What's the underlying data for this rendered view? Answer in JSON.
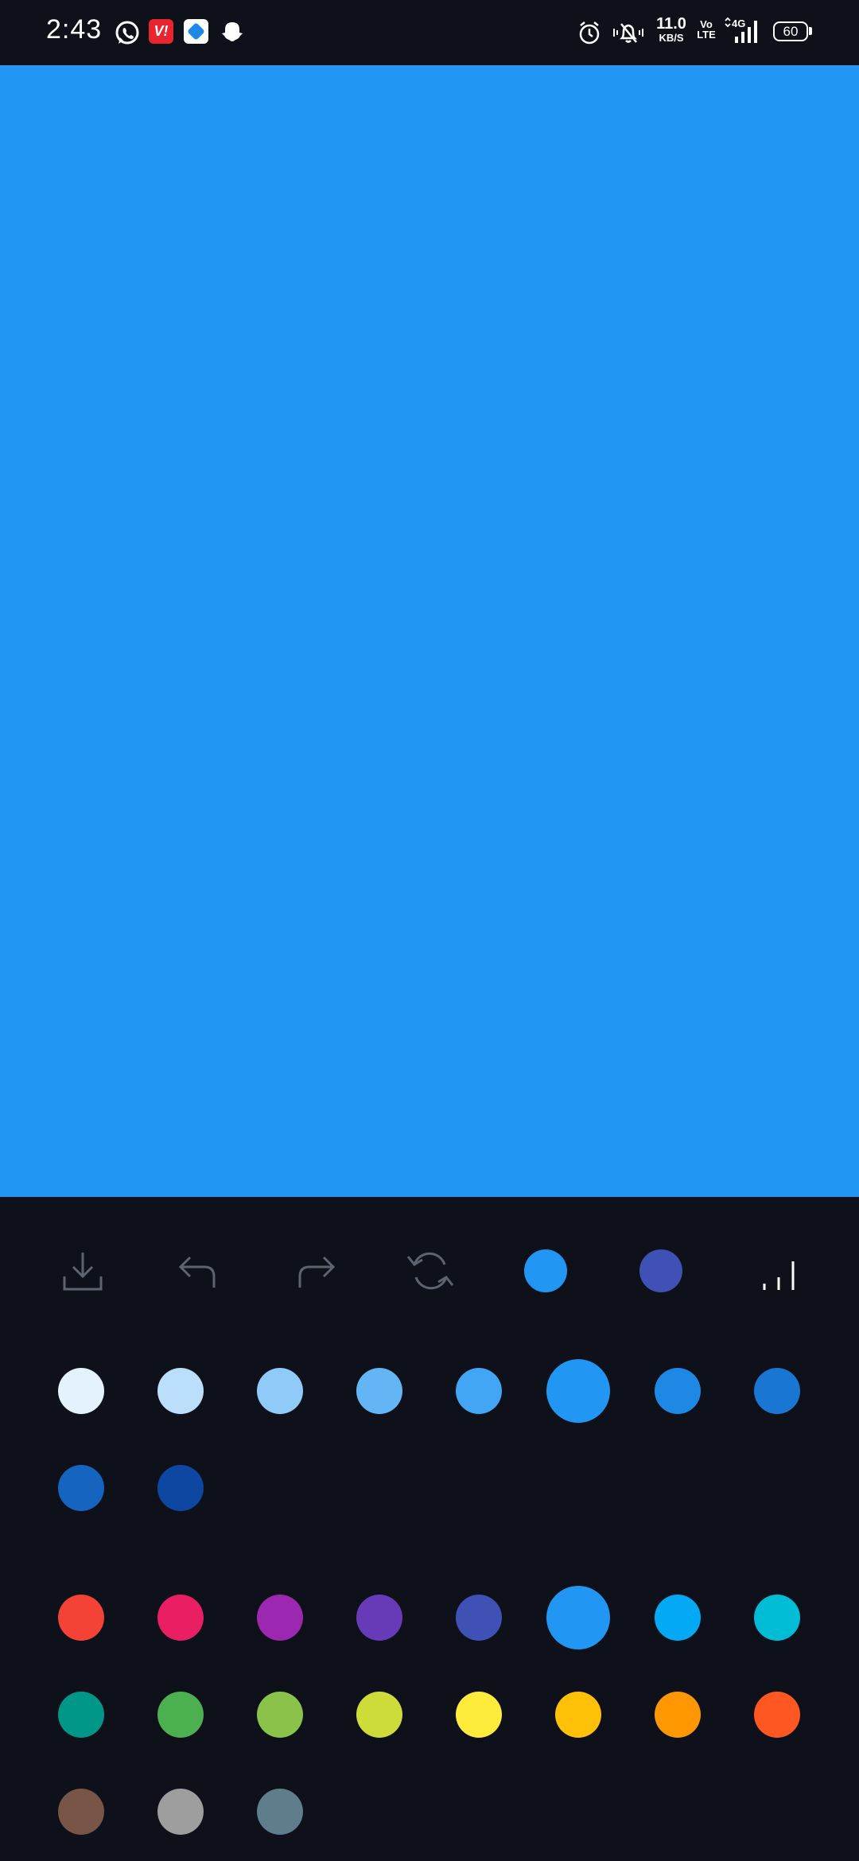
{
  "status_bar": {
    "time": "2:43",
    "net_speed_value": "11.0",
    "net_speed_unit": "KB/S",
    "volte_top": "Vo",
    "volte_bottom": "LTE",
    "network_type": "4G",
    "battery": "60",
    "notification_icons": [
      "whatsapp-icon",
      "vi-app-icon",
      "photo-app-icon",
      "snapchat-icon"
    ],
    "system_icons": [
      "alarm-icon",
      "vibrate-mute-icon",
      "signal-icon"
    ]
  },
  "canvas": {
    "color": "#2196f3"
  },
  "toolbar": {
    "tools": [
      "download-icon",
      "undo-icon",
      "redo-icon",
      "refresh-icon",
      "primary-color-swatch",
      "secondary-color-swatch",
      "brush-size-icon"
    ],
    "primary_color": "#2196f3",
    "secondary_color": "#3f51b5"
  },
  "shade_palette": {
    "colors": [
      "#e3f2fd",
      "#bbdefb",
      "#90caf9",
      "#64b5f6",
      "#42a5f5",
      "#2196f3",
      "#1e88e5",
      "#1976d2",
      "#1565c0",
      "#0d47a1"
    ],
    "selected_index": 5
  },
  "hue_palette": {
    "colors": [
      "#f44336",
      "#e91e63",
      "#9c27b0",
      "#673ab7",
      "#3f51b5",
      "#2196f3",
      "#03a9f4",
      "#00bcd4",
      "#009688",
      "#4caf50",
      "#8bc34a",
      "#cddc39",
      "#ffeb3b",
      "#ffc107",
      "#ff9800",
      "#ff5722",
      "#795548",
      "#9e9e9e",
      "#607d8b"
    ],
    "selected_index": 5
  }
}
